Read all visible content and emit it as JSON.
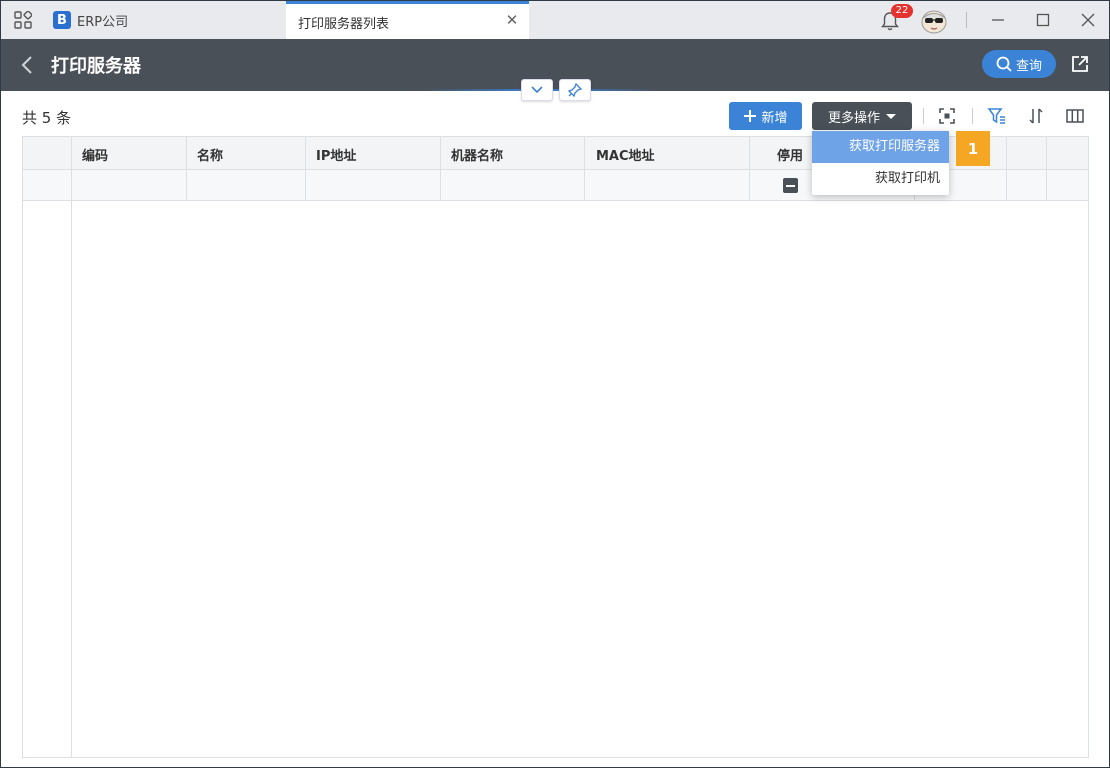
{
  "window": {
    "app_name": "ERP公司",
    "app_logo_letter": "B",
    "active_tab_title": "打印服务器列表",
    "notification_count": "22",
    "accent_color": "#3a83d7",
    "header_color": "#4a5058",
    "badge_color": "#e5322e"
  },
  "header": {
    "title": "打印服务器",
    "query_label": "查询"
  },
  "toolbar": {
    "count_text": "共 5 条",
    "add_label": "新增",
    "more_label": "更多操作"
  },
  "table": {
    "columns": [
      "编码",
      "名称",
      "IP地址",
      "机器名称",
      "MAC地址",
      "停用"
    ]
  },
  "dropdown": {
    "items": [
      "获取打印服务器",
      "获取打印机"
    ],
    "highlight_color": "#6fa3e8"
  },
  "step_badge": {
    "label": "1",
    "color": "#f5a623"
  }
}
